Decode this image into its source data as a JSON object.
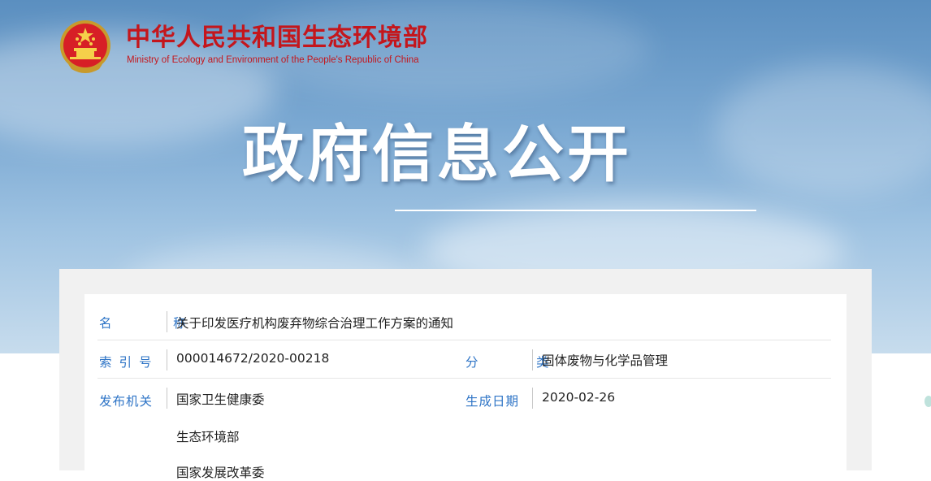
{
  "header": {
    "org_name_cn": "中华人民共和国生态环境部",
    "org_name_en": "Ministry of Ecology and Environment of the People's Republic of China",
    "emblem_icon": "national-emblem-icon",
    "section_title": "政府信息公开"
  },
  "colors": {
    "org_red": "#c4161c",
    "label_blue": "#2e74c6",
    "banner_sky": "#7aa8d2"
  },
  "info": {
    "name_label": "名　称",
    "name_value": "关于印发医疗机构废弃物综合治理工作方案的通知",
    "index_label": "索引号",
    "index_value": "000014672/2020-00218",
    "category_label": "分　类",
    "category_value": "固体废物与化学品管理",
    "issuer_label": "发布机关",
    "issuers": [
      "国家卫生健康委",
      "生态环境部",
      "国家发展改革委"
    ],
    "date_label": "生成日期",
    "date_value": "2020-02-26"
  }
}
